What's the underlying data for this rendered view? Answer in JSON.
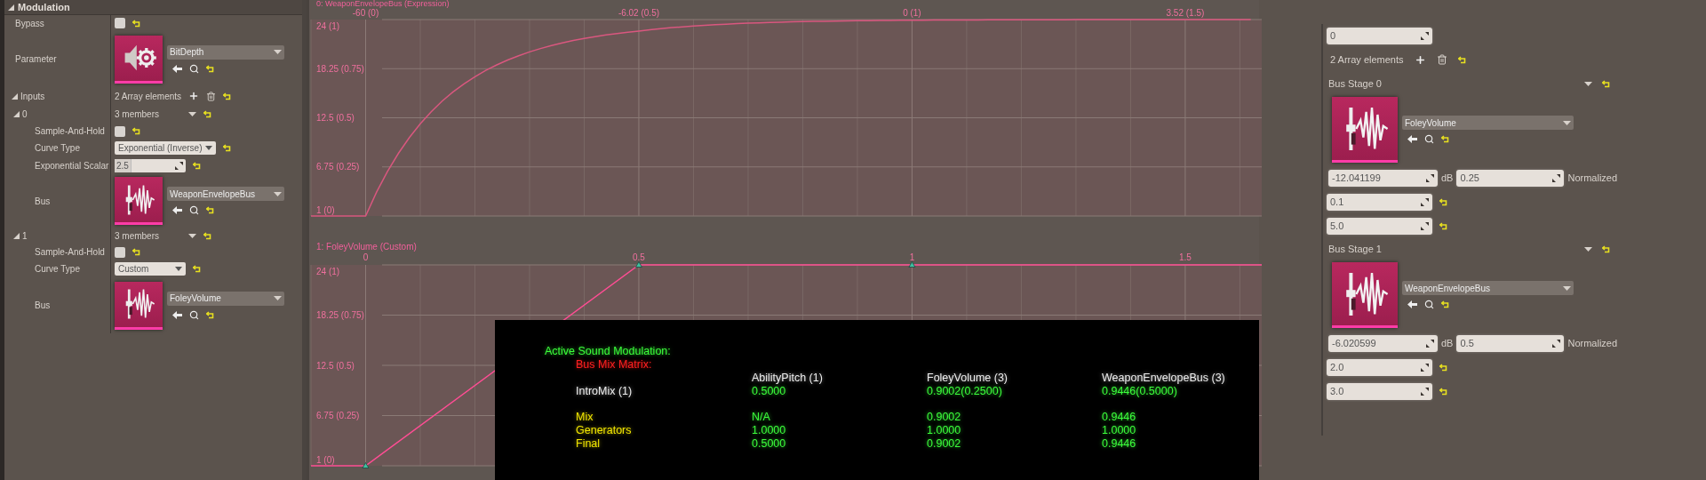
{
  "details": {
    "section": {
      "title": "Modulation",
      "expanded": true
    },
    "bypass": {
      "label": "Bypass",
      "checked": false
    },
    "parameter": {
      "label": "Parameter",
      "asset": "BitDepth"
    },
    "inputs": {
      "label": "Inputs",
      "expanded": true,
      "count": "2 Array elements",
      "elements": [
        {
          "index": "0",
          "expanded": true,
          "members": "3 members",
          "sample_and_hold": {
            "label": "Sample-And-Hold",
            "checked": false
          },
          "curve_type": {
            "label": "Curve Type",
            "value": "Exponential (Inverse)"
          },
          "exponential_scalar": {
            "label": "Exponential Scalar",
            "value": "2.5"
          },
          "bus": {
            "label": "Bus",
            "asset": "WeaponEnvelopeBus"
          }
        },
        {
          "index": "1",
          "expanded": true,
          "members": "3 members",
          "sample_and_hold": {
            "label": "Sample-And-Hold",
            "checked": false
          },
          "curve_type": {
            "label": "Curve Type",
            "value": "Custom"
          },
          "bus": {
            "label": "Bus",
            "asset": "FoleyVolume"
          }
        }
      ]
    }
  },
  "graphs": [
    {
      "title": "0: WeaponEnvelopeBus (Expression)",
      "kind": "exponential",
      "x_labels": [
        "-60 (0)",
        "-6.02 (0.5)",
        "0 (1)",
        "3.52 (1.5)"
      ],
      "y_labels": [
        "24 (1)",
        "18.25 (0.75)",
        "12.5 (0.5)",
        "6.75 (0.25)",
        "1 (0)"
      ]
    },
    {
      "title": "1: FoleyVolume (Custom)",
      "kind": "ramp",
      "x_labels": [
        "0",
        "0.5",
        "1",
        "1.5"
      ],
      "y_labels": [
        "24 (1)",
        "18.25 (0.75)",
        "12.5 (0.5)",
        "6.75 (0.25)",
        "1 (0)"
      ]
    }
  ],
  "debug_overlay": {
    "title": "Active Sound Modulation:",
    "matrix_title": "Bus Mix Matrix:",
    "columns": [
      "AbilityPitch (1)",
      "FoleyVolume (3)",
      "WeaponEnvelopeBus (3)"
    ],
    "mixes": [
      {
        "name": "IntroMix (1)",
        "values": [
          "0.5000",
          "0.9002(0.2500)",
          "0.9446(0.5000)"
        ]
      }
    ],
    "summary": [
      {
        "label": "Mix",
        "values": [
          "N/A",
          "0.9002",
          "0.9446"
        ]
      },
      {
        "label": "Generators",
        "values": [
          "1.0000",
          "1.0000",
          "1.0000"
        ]
      },
      {
        "label": "Final",
        "values": [
          "0.5000",
          "0.9002",
          "0.9446"
        ]
      }
    ]
  },
  "bus_stages_panel": {
    "top_field": "0",
    "count": "2 Array elements",
    "stages": [
      {
        "title": "Bus Stage 0",
        "asset": "FoleyVolume",
        "db_value": "-12.041199",
        "db_unit": "dB",
        "normalized_value": "0.25",
        "normalized_label": "Normalized",
        "fields": [
          "0.1",
          "5.0"
        ]
      },
      {
        "title": "Bus Stage 1",
        "asset": "WeaponEnvelopeBus",
        "db_value": "-6.020599",
        "db_unit": "dB",
        "normalized_value": "0.5",
        "normalized_label": "Normalized",
        "fields": [
          "2.0",
          "3.0"
        ]
      }
    ]
  }
}
